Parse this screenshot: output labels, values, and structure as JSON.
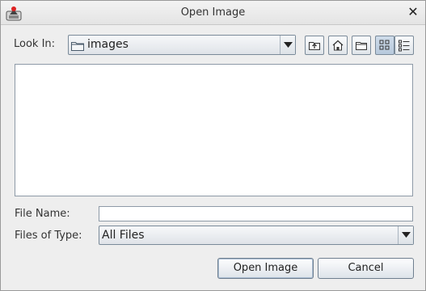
{
  "window": {
    "title": "Open Image",
    "app_icon": "java-app-icon",
    "close_icon": "close-icon"
  },
  "look_in": {
    "label": "Look In:",
    "value": "images",
    "icon": "folder-icon"
  },
  "toolbar": {
    "buttons": [
      {
        "name": "up-one-level",
        "icon": "folder-up-icon"
      },
      {
        "name": "home",
        "icon": "home-icon"
      },
      {
        "name": "new-folder",
        "icon": "new-folder-icon"
      },
      {
        "name": "list-view",
        "icon": "list-view-icon",
        "selected": true
      },
      {
        "name": "details-view",
        "icon": "details-view-icon",
        "selected": false
      }
    ]
  },
  "file_list": {
    "items": []
  },
  "file_name": {
    "label": "File Name:",
    "value": ""
  },
  "files_of_type": {
    "label": "Files of Type:",
    "value": "All Files"
  },
  "actions": {
    "open_label": "Open Image",
    "cancel_label": "Cancel"
  },
  "colors": {
    "window_bg": "#eeeeee",
    "accent": "#b7c9dc",
    "border": "#7a8a99"
  }
}
